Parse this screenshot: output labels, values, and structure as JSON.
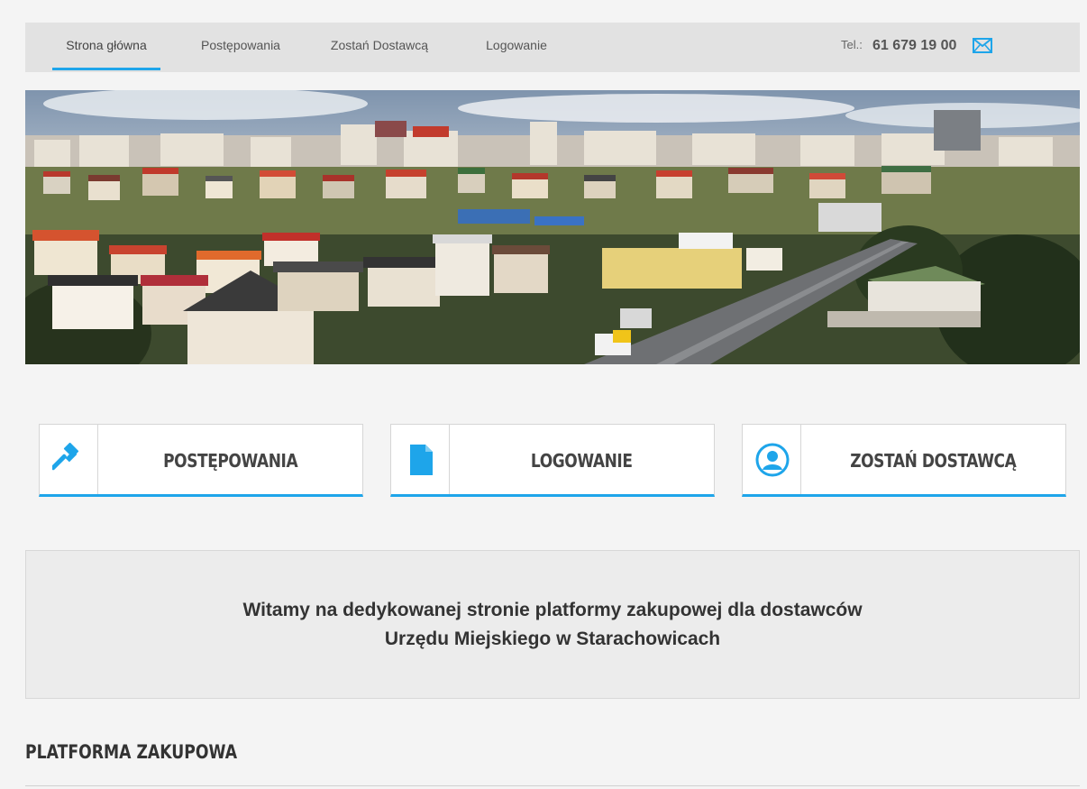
{
  "nav": {
    "items": [
      {
        "label": "Strona główna"
      },
      {
        "label": "Postępowania"
      },
      {
        "label": "Zostań Dostawcą"
      },
      {
        "label": "Logowanie"
      }
    ],
    "tel_label": "Tel.:",
    "tel_number": "61 679 19 00",
    "mail_icon": "envelope-icon"
  },
  "hero": {
    "alt": "panorama-of-town-image"
  },
  "tiles": [
    {
      "label": "POSTĘPOWANIA",
      "icon": "gavel-icon"
    },
    {
      "label": "LOGOWANIE",
      "icon": "document-icon"
    },
    {
      "label": "ZOSTAŃ DOSTAWCĄ",
      "icon": "user-circle-icon"
    }
  ],
  "welcome": {
    "line1": "Witamy na dedykowanej stronie platformy zakupowej dla dostawców",
    "line2": "Urzędu Miejskiego w Starachowicach"
  },
  "section": {
    "title": "PLATFORMA ZAKUPOWA"
  },
  "colors": {
    "accent": "#1ea5ea",
    "nav_bg": "#e2e2e2",
    "page_bg": "#f4f4f4"
  }
}
